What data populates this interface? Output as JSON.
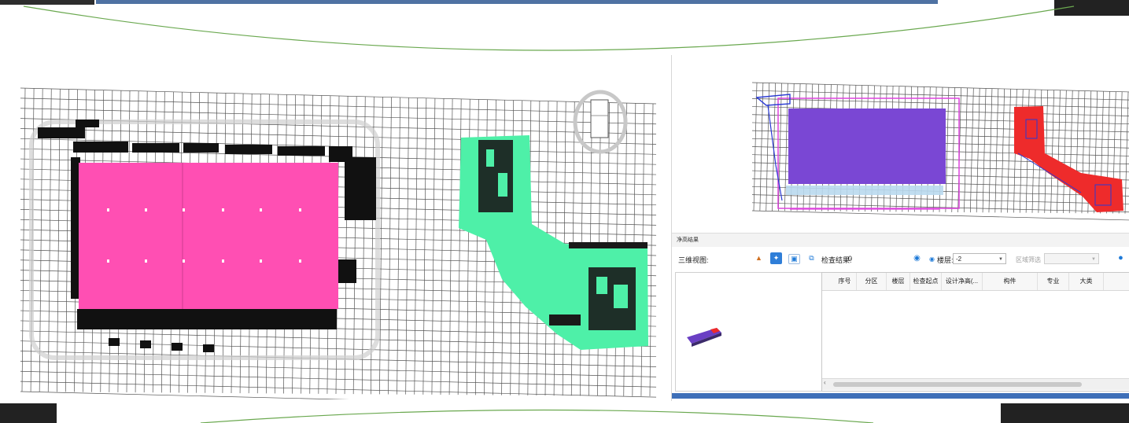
{
  "colors": {
    "slab_left": "#ff4fb3",
    "region_left": "#4ef0a8",
    "slab_right": "#7a47d4",
    "region_right": "#ee2b2b",
    "outline_right": "#dd44dd",
    "pipe_right": "#2a3ad4",
    "grid": "#555555",
    "accent": "#1e7ad8",
    "deco_line": "#6aa84f"
  },
  "result_panel": {
    "title": "净高结果"
  },
  "toolbar": {
    "view_label": "三维视图:",
    "icons": [
      "display-icon",
      "fit-view-icon",
      "section-box-icon",
      "copy-icon"
    ],
    "check_result_label": "检查结果:",
    "check_result_value": "0",
    "eye_icon": "eye-icon",
    "floor_label": "楼层:",
    "floor_value": "-2",
    "area_filter_label": "区域筛选",
    "area_filter_value": "",
    "locate_icon": "locate-pin-icon"
  },
  "table": {
    "columns": [
      "序号",
      "分区",
      "楼层",
      "检查起点",
      "设计净高(...",
      "构件",
      "专业",
      "大类"
    ],
    "rows": []
  }
}
